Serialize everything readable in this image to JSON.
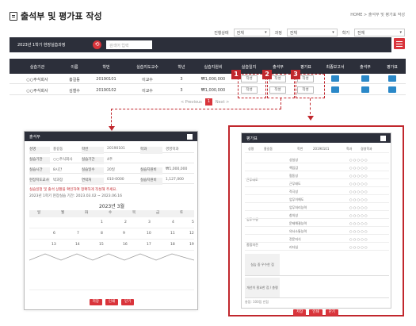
{
  "header": {
    "title": "출석부 및 평가표 작성",
    "breadcrumb": "HOME > 출석부 및 평가표 작성"
  },
  "filters": {
    "label1": "진행상태",
    "select1": "전체",
    "label2": "과정",
    "select2": "전체",
    "label3": "학기",
    "select3": "전체"
  },
  "toolbar": {
    "label": "2023년 1학기 현장실습과정",
    "search_placeholder": "검색어 입력"
  },
  "table": {
    "headers": [
      "실습기관",
      "이름",
      "학번",
      "실습지도교수",
      "학년",
      "실습지원비",
      "실습일지",
      "출석부",
      "평가표",
      "최종보고서",
      "출석부",
      "평가표"
    ],
    "rows": [
      {
        "org": "○○주식회사",
        "name": "홍길동",
        "id": "20190101",
        "prof": "이교수",
        "year": "3",
        "fee": "₩1,000,000",
        "b1": "작성",
        "b2": "작성",
        "b3": "작성"
      },
      {
        "org": "○○주식회사",
        "name": "김철수",
        "id": "20190102",
        "prof": "이교수",
        "year": "3",
        "fee": "₩1,000,000",
        "b1": "작성",
        "b2": "작성",
        "b3": "작성"
      }
    ],
    "badges": [
      "1",
      "2",
      "3"
    ]
  },
  "pager": {
    "prev": "< Previous",
    "page": "1",
    "next": "Next >"
  },
  "attendance": {
    "title": "출석부",
    "info": [
      {
        "k1": "성명",
        "v1": "홍길동",
        "k2": "학번",
        "v2": "20190101",
        "k3": "학과",
        "v3": "경영학과"
      },
      {
        "k1": "실습기관",
        "v1": "○○주식회사",
        "k2": "실습기간",
        "v2": "4주",
        "k3": "",
        "v3": ""
      },
      {
        "k1": "실습시간",
        "v1": "8시간",
        "k2": "실습일수",
        "v2": "20일",
        "k3": "실습지원비",
        "v3": "₩1,000,000"
      },
      {
        "k1": "현장지도교사",
        "v1": "박과장",
        "k2": "연락처",
        "v2": "010-0000",
        "k3": "실습지원비",
        "v3": "1,127,000"
      }
    ],
    "warning": "실습일정 및 출석 상황을 확인하여 정확하게 작성해 주세요.",
    "note": "2023년 1학기 현장실습 기간: 2023.03.02 ~ 2023.06.16",
    "month": "2023년 3월",
    "weekdays": [
      "일",
      "월",
      "화",
      "수",
      "목",
      "금",
      "토"
    ],
    "week1": [
      "",
      "",
      "1",
      "2",
      "3",
      "4",
      "5"
    ],
    "week2": [
      "6",
      "7",
      "8",
      "9",
      "10",
      "11",
      "12"
    ],
    "week3": [
      "13",
      "14",
      "15",
      "16",
      "17",
      "18",
      "19"
    ],
    "week_last": [
      "",
      "",
      "",
      "",
      "",
      "",
      ""
    ],
    "btn_save": "저장",
    "btn_print": "인쇄",
    "btn_close": "닫기"
  },
  "evaluation": {
    "title": "평가표",
    "name_label": "성명",
    "name": "홍길동",
    "id_label": "학번",
    "id": "20190101",
    "dept_label": "학과",
    "dept": "경영학과",
    "groups": [
      "근무태도",
      "업무수행",
      "종합의견"
    ],
    "items": [
      "성실성",
      "책임감",
      "협동성",
      "근무태도",
      "적극성",
      "업무이해도",
      "업무처리능력",
      "창의성",
      "문제해결능력",
      "의사소통능력",
      "전문지식",
      "리더십",
      "종합평가"
    ],
    "textarea1": "실습 중\n우수한 점",
    "textarea2": "개선이 필요한 점\n/ 총평",
    "footer_note": "총점: 100점 만점",
    "btn_save": "저장",
    "btn_print": "인쇄",
    "btn_close": "닫기"
  },
  "colors": {
    "accent": "#c1272d",
    "dark": "#2c2f3a",
    "blue": "#2a88c8"
  }
}
